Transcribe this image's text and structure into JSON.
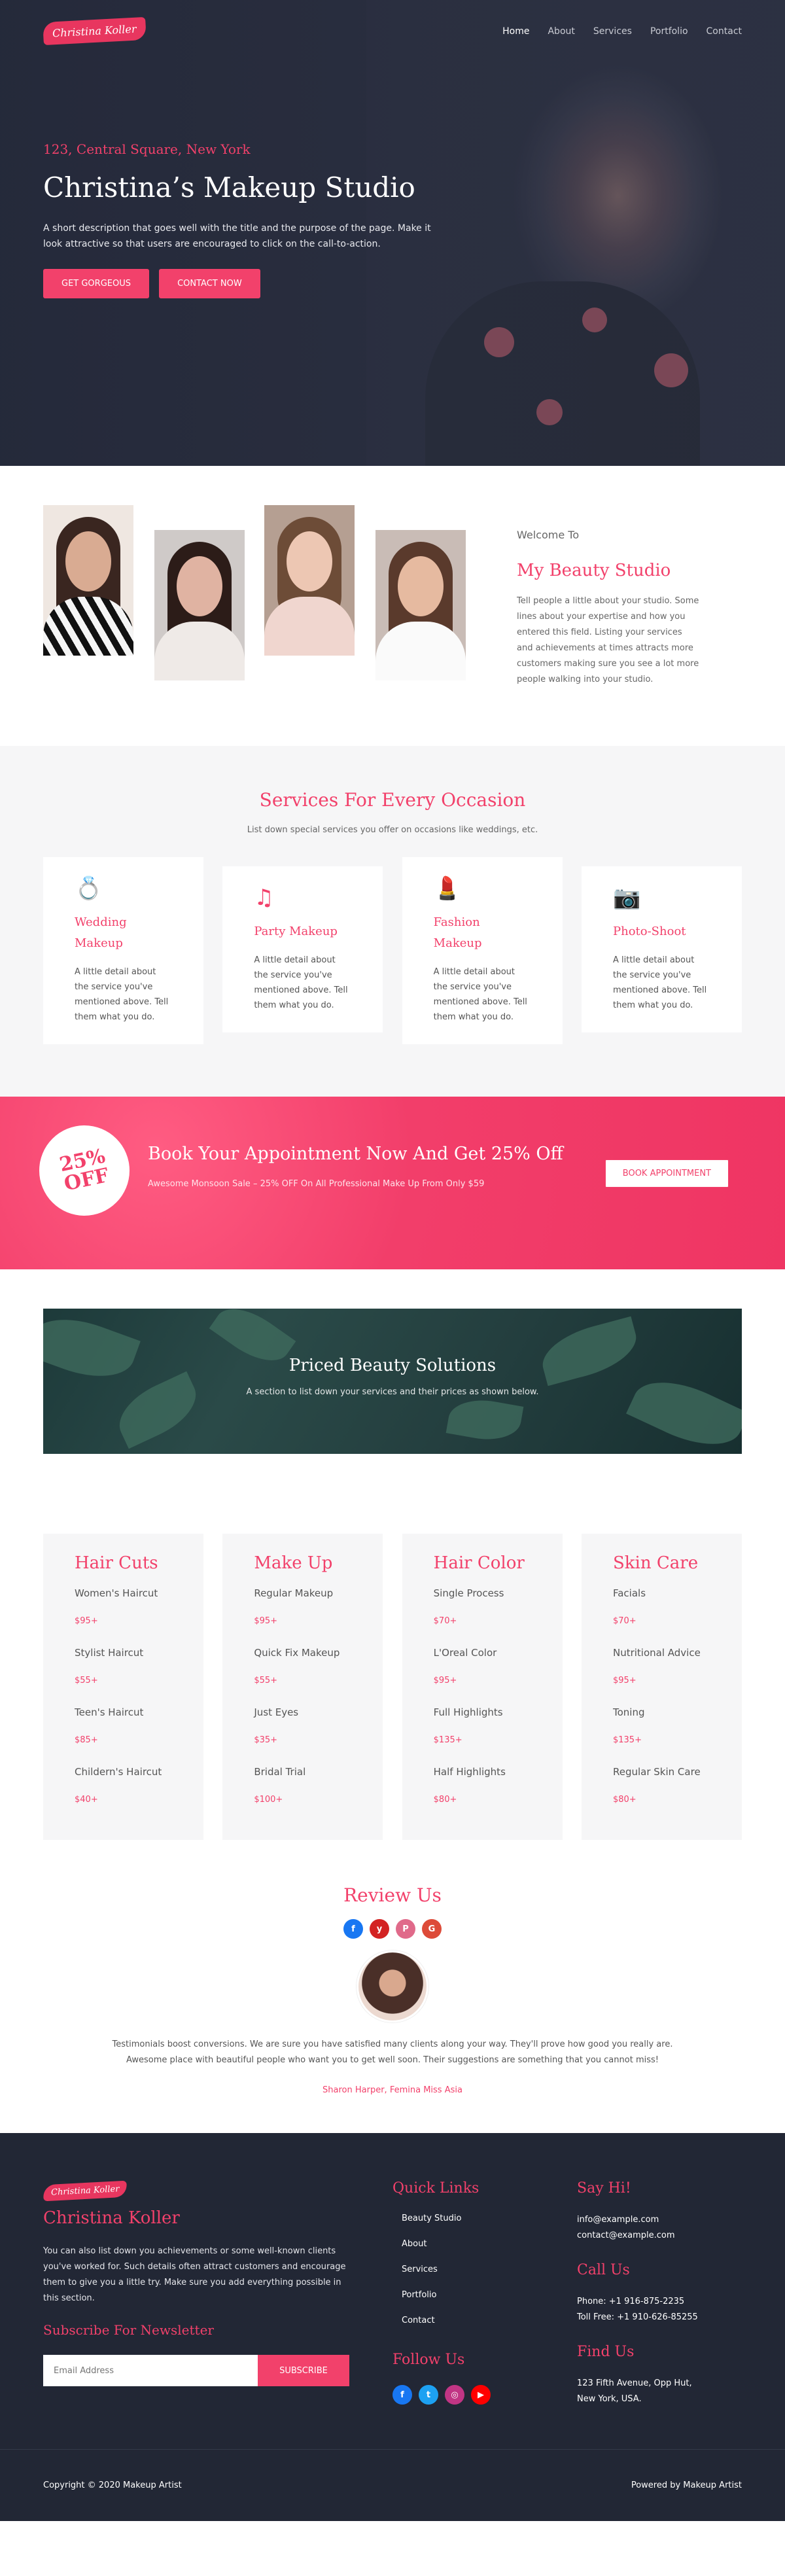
{
  "brand": {
    "logo_text": "Christina Koller",
    "accent": "#f2416b",
    "dark": "#222735"
  },
  "nav": {
    "items": [
      "Home",
      "About",
      "Services",
      "Portfolio",
      "Contact"
    ],
    "active": "Home"
  },
  "hero": {
    "address": "123, Central Square, New York",
    "title": "Christina’s Makeup Studio",
    "description": "A short description that goes well with the title and the purpose of the page. Make it look attractive so that users are encouraged to click on the call-to-action.",
    "primary_button": "GET GORGEOUS",
    "secondary_button": "CONTACT NOW"
  },
  "about": {
    "eyebrow": "Welcome To",
    "title": "My Beauty Studio",
    "text": "Tell people a little about your studio. Some lines about your expertise and how you entered this field. Listing your services and achievements at times attracts more customers making sure you see a lot more people walking into your studio."
  },
  "services": {
    "title": "Services For Every Occasion",
    "subtitle": "List down special services you offer on occasions like weddings, etc.",
    "cards": [
      {
        "icon": "ring-icon",
        "glyph": "💍",
        "title": "Wedding Makeup",
        "text": "A little detail about the service you've mentioned above. Tell them what you do."
      },
      {
        "icon": "music-note-icon",
        "glyph": "♫",
        "title": "Party Makeup",
        "text": "A little detail about the service you've mentioned above. Tell them what you do."
      },
      {
        "icon": "lipstick-icon",
        "glyph": "💄",
        "title": "Fashion Makeup",
        "text": "A little detail about the service you've mentioned above. Tell them what you do."
      },
      {
        "icon": "camera-icon",
        "glyph": "📷",
        "title": "Photo-Shoot",
        "text": "A little detail about the service you've mentioned above. Tell them what you do."
      }
    ]
  },
  "offer": {
    "badge_percent": "25%",
    "badge_word": "OFF",
    "title": "Book Your Appointment Now And Get 25% Off",
    "subtitle": "Awesome Monsoon Sale – 25% OFF On All Professional Make Up From Only $59",
    "button": "BOOK APPOINTMENT"
  },
  "priced": {
    "title": "Priced Beauty Solutions",
    "subtitle": "A section to list down your services and their prices as shown below."
  },
  "prices": [
    {
      "category": "Hair Cuts",
      "items": [
        {
          "name": "Women's Haircut",
          "price": "$95+"
        },
        {
          "name": "Stylist Haircut",
          "price": "$55+"
        },
        {
          "name": "Teen's Haircut",
          "price": "$85+"
        },
        {
          "name": "Childern's Haircut",
          "price": "$40+"
        }
      ]
    },
    {
      "category": "Make Up",
      "items": [
        {
          "name": "Regular Makeup",
          "price": "$95+"
        },
        {
          "name": "Quick Fix Makeup",
          "price": "$55+"
        },
        {
          "name": "Just Eyes",
          "price": "$35+"
        },
        {
          "name": "Bridal Trial",
          "price": "$100+"
        }
      ]
    },
    {
      "category": "Hair Color",
      "items": [
        {
          "name": "Single Process",
          "price": "$70+"
        },
        {
          "name": "L'Oreal Color",
          "price": "$95+"
        },
        {
          "name": "Full Highlights",
          "price": "$135+"
        },
        {
          "name": "Half Highlights",
          "price": "$80+"
        }
      ]
    },
    {
      "category": "Skin Care",
      "items": [
        {
          "name": "Facials",
          "price": "$70+"
        },
        {
          "name": "Nutritional Advice",
          "price": "$95+"
        },
        {
          "name": "Toning",
          "price": "$135+"
        },
        {
          "name": "Regular Skin Care",
          "price": "$80+"
        }
      ]
    }
  ],
  "review": {
    "title": "Review Us",
    "platforms": [
      {
        "icon": "facebook-icon",
        "glyph": "f",
        "color": "#1877f2"
      },
      {
        "icon": "yelp-icon",
        "glyph": "y",
        "color": "#d32323"
      },
      {
        "icon": "pinterest-icon",
        "glyph": "P",
        "color": "#e06a8a"
      },
      {
        "icon": "google-icon",
        "glyph": "G",
        "color": "#dd4b39"
      }
    ],
    "text": "Testimonials boost conversions. We are sure you have satisfied many clients along your way. They'll prove how good you really are. Awesome place with beautiful people who want you to get well soon. Their suggestions are something that you cannot miss!",
    "author": "Sharon Harper, Femina Miss Asia"
  },
  "footer": {
    "logo_text": "Christina Koller",
    "name": "Christina Koller",
    "about": "You can also list down you achievements or some well-known clients you've worked for. Such details often attract customers and encourage them to give you a little try. Make sure you add everything possible in this section.",
    "newsletter_title": "Subscribe For Newsletter",
    "email_placeholder": "Email Address",
    "subscribe_button": "SUBSCRIBE",
    "links_title": "Quick Links",
    "links": [
      "Beauty Studio",
      "About",
      "Services",
      "Portfolio",
      "Contact"
    ],
    "follow_title": "Follow Us",
    "follow": [
      {
        "icon": "facebook-icon",
        "glyph": "f",
        "color": "#1877f2"
      },
      {
        "icon": "twitter-icon",
        "glyph": "t",
        "color": "#1da1f2"
      },
      {
        "icon": "instagram-icon",
        "glyph": "◎",
        "color": "#c13584"
      },
      {
        "icon": "youtube-icon",
        "glyph": "▶",
        "color": "#ff0000"
      }
    ],
    "say_hi_title": "Say Hi!",
    "emails": [
      "info@example.com",
      "contact@example.com"
    ],
    "call_title": "Call Us",
    "phones": [
      "Phone: +1 916-875-2235",
      "Toll Free: +1 910-626-85255"
    ],
    "find_title": "Find Us",
    "address": [
      "123 Fifth Avenue, Opp Hut,",
      "New York, USA."
    ],
    "copyright": "Copyright © 2020 Makeup Artist",
    "powered": "Powered by Makeup Artist"
  }
}
